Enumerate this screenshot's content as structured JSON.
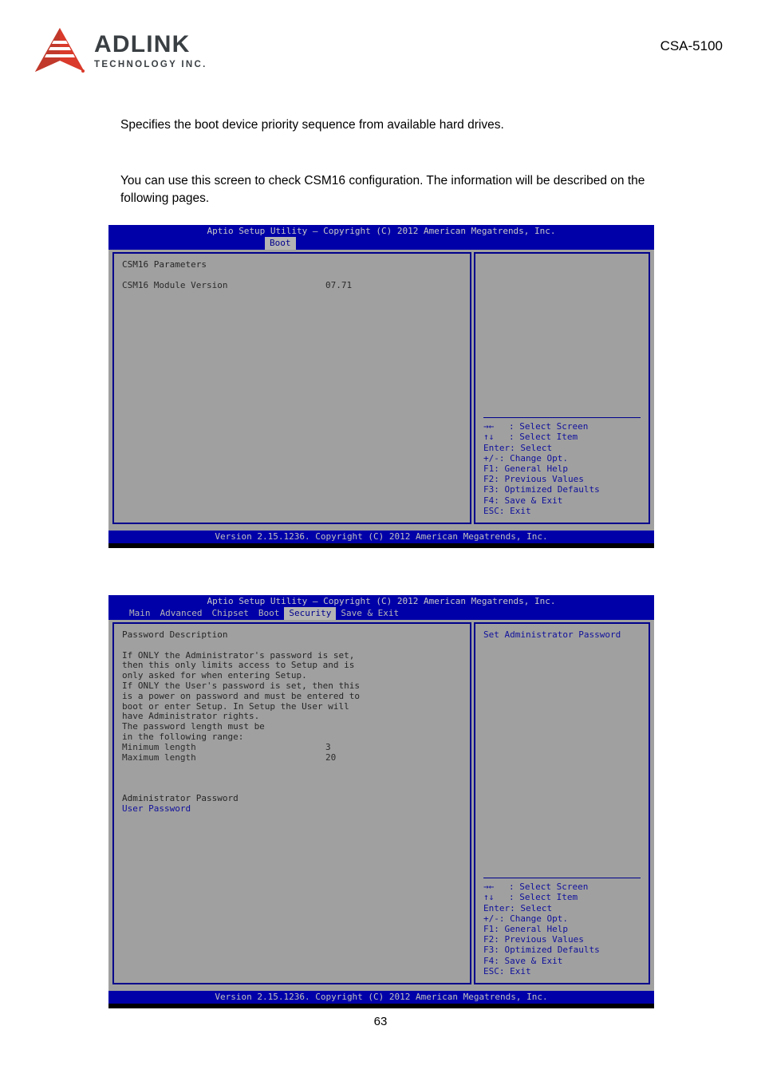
{
  "header": {
    "logo_primary": "ADLINK",
    "logo_secondary": "TECHNOLOGY INC.",
    "model": "CSA-5100"
  },
  "body": {
    "paragraph_1": "Specifies the boot device priority sequence from available hard drives.",
    "paragraph_2": "You can use this screen to check CSM16 configuration. The information will be described on the following pages."
  },
  "bios_screen_1": {
    "title": "Aptio Setup Utility – Copyright (C) 2012 American Megatrends, Inc.",
    "tabs": [
      {
        "label": "Boot",
        "active": true
      }
    ],
    "left_panel": {
      "section_heading": "CSM16 Parameters",
      "rows": [
        {
          "key": "CSM16 Module Version",
          "value": "07.71"
        }
      ]
    },
    "right_panel": {
      "help_text": "",
      "legend": [
        {
          "symbol": "→←",
          "label": ": Select Screen"
        },
        {
          "symbol": "↑↓",
          "label": ": Select Item"
        },
        {
          "symbol": "Enter",
          "label": ": Select"
        },
        {
          "symbol": "+/-",
          "label": ": Change Opt."
        },
        {
          "symbol": "F1",
          "label": ": General Help"
        },
        {
          "symbol": "F2",
          "label": ": Previous Values"
        },
        {
          "symbol": "F3",
          "label": ": Optimized Defaults"
        },
        {
          "symbol": "F4",
          "label": ": Save & Exit"
        },
        {
          "symbol": "ESC",
          "label": ": Exit"
        }
      ]
    },
    "footer": "Version 2.15.1236. Copyright (C) 2012 American Megatrends, Inc."
  },
  "bios_screen_2": {
    "title": "Aptio Setup Utility – Copyright (C) 2012 American Megatrends, Inc.",
    "tabs": [
      {
        "label": "Main",
        "active": false
      },
      {
        "label": "Advanced",
        "active": false
      },
      {
        "label": "Chipset",
        "active": false
      },
      {
        "label": "Boot",
        "active": false
      },
      {
        "label": "Security",
        "active": true
      },
      {
        "label": "Save & Exit",
        "active": false
      }
    ],
    "left_panel": {
      "section_heading": "Password Description",
      "description_lines": [
        "If ONLY the Administrator's password is set,",
        "then this only limits access to Setup and is",
        "only asked for when entering Setup.",
        "If ONLY the User's password is set, then this",
        "is a power on password and must be entered to",
        "boot or enter Setup. In Setup the User will",
        "have Administrator rights.",
        "The password length must be",
        "in the following range:"
      ],
      "length_rows": [
        {
          "key": "Minimum length",
          "value": "3"
        },
        {
          "key": "Maximum length",
          "value": "20"
        }
      ],
      "password_items": [
        {
          "label": "Administrator Password",
          "highlight": false
        },
        {
          "label": "User Password",
          "highlight": true
        }
      ]
    },
    "right_panel": {
      "help_text": "Set Administrator Password",
      "legend": [
        {
          "symbol": "→←",
          "label": ": Select Screen"
        },
        {
          "symbol": "↑↓",
          "label": ": Select Item"
        },
        {
          "symbol": "Enter",
          "label": ": Select"
        },
        {
          "symbol": "+/-",
          "label": ": Change Opt."
        },
        {
          "symbol": "F1",
          "label": ": General Help"
        },
        {
          "symbol": "F2",
          "label": ": Previous Values"
        },
        {
          "symbol": "F3",
          "label": ": Optimized Defaults"
        },
        {
          "symbol": "F4",
          "label": ": Save & Exit"
        },
        {
          "symbol": "ESC",
          "label": ": Exit"
        }
      ]
    },
    "footer": "Version 2.15.1236. Copyright (C) 2012 American Megatrends, Inc."
  },
  "page_number": "63"
}
